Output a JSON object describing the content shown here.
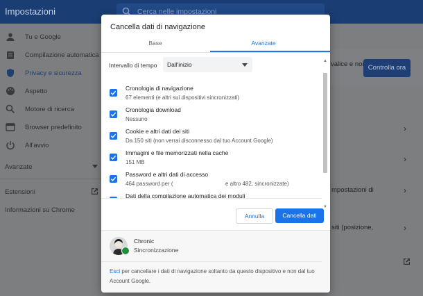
{
  "app": {
    "title": "Impostazioni",
    "search_placeholder": "Cerca nelle impostazioni"
  },
  "sidebar": {
    "items": [
      {
        "label": "Tu e Google",
        "icon": "person-icon"
      },
      {
        "label": "Compilazione automatica",
        "icon": "clipboard-icon"
      },
      {
        "label": "Privacy e sicurezza",
        "icon": "shield-icon"
      },
      {
        "label": "Aspetto",
        "icon": "palette-icon"
      },
      {
        "label": "Motore di ricerca",
        "icon": "search-icon"
      },
      {
        "label": "Browser predefinito",
        "icon": "browser-icon"
      },
      {
        "label": "All'avvio",
        "icon": "power-icon"
      }
    ],
    "advanced_label": "Avanzate",
    "extensions_label": "Estensioni",
    "about_label": "Informazioni su Chrome"
  },
  "background": {
    "partial_text_1": "valice e non",
    "check_now_button": "Controlla ora",
    "partial_text_2": "mpostazioni di",
    "partial_text_3": "siti (posizione,"
  },
  "dialog": {
    "title": "Cancella dati di navigazione",
    "tabs": {
      "basic": "Base",
      "advanced": "Avanzate"
    },
    "time_range": {
      "label": "Intervallo di tempo",
      "value": "Dall'inizio"
    },
    "items": [
      {
        "title": "Cronologia di navigazione",
        "subtitle": "67 elementi (e altri sui dispositivi sincronizzati)",
        "checked": true
      },
      {
        "title": "Cronologia download",
        "subtitle": "Nessuno",
        "checked": true
      },
      {
        "title": "Cookie e altri dati dei siti",
        "subtitle": "Da 150 siti (non verrai disconnesso dal tuo Account Google)",
        "checked": true
      },
      {
        "title": "Immagini e file memorizzati nella cache",
        "subtitle": "151 MB",
        "checked": true
      },
      {
        "title": "Password e altri dati di accesso",
        "subtitle_left": "464 password per (",
        "subtitle_right": "e altro 482, sincronizzate)",
        "checked": true
      },
      {
        "title": "Dati della compilazione automatica dei moduli",
        "subtitle": "",
        "checked": true
      }
    ],
    "cancel_label": "Annulla",
    "clear_label": "Cancella dati",
    "account": {
      "name": "Chronic",
      "sync_status": "Sincronizzazione"
    },
    "note_link": "Esci",
    "note_text": " per cancellare i dati di navigazione soltanto da questo dispositivo e non dal tuo Account Google."
  },
  "colors": {
    "accent": "#1a73e8",
    "topbar": "#1a3d73",
    "overlay": "#7d7e80"
  }
}
